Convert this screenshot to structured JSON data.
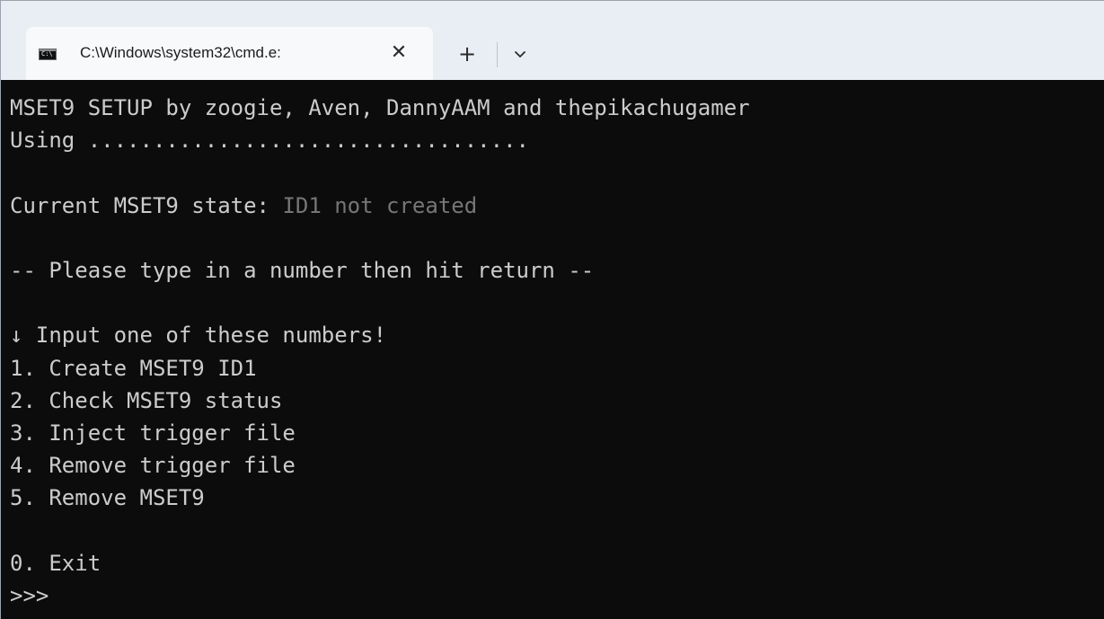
{
  "window": {
    "tab_title": "C:\\Windows\\system32\\cmd.e:",
    "tab_icon_text": "C:\\",
    "tab_close": "✕",
    "new_tab": "+",
    "dropdown": "chevron-down-icon"
  },
  "terminal": {
    "lines": [
      "MSET9 SETUP by zoogie, Aven, DannyAAM and thepikachugamer",
      "Using ..................................",
      "",
      "",
      "",
      "-- Please type in a number then hit return --",
      "",
      "↓ Input one of these numbers!",
      "1. Create MSET9 ID1",
      "2. Check MSET9 status",
      "3. Inject trigger file",
      "4. Remove trigger file",
      "5. Remove MSET9",
      "",
      "0. Exit",
      ">>>"
    ],
    "state_label": "Current MSET9 state: ",
    "state_value": "ID1 not created"
  },
  "colors": {
    "terminal_bg": "#0c0c0c",
    "terminal_fg": "#cccccc",
    "dim_fg": "#767676",
    "titlebar_bg": "#e9eef4",
    "tab_bg": "#f7f9fb"
  }
}
